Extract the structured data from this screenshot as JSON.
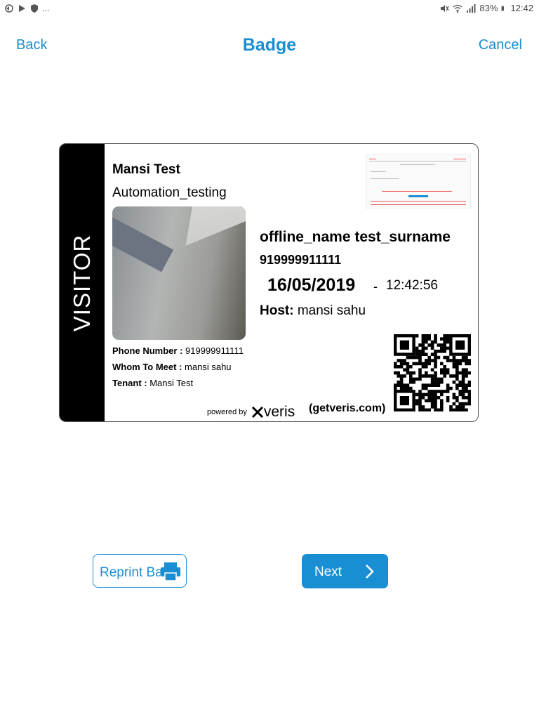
{
  "status_bar": {
    "left_more": "...",
    "battery": "83%",
    "time": "12:42"
  },
  "header": {
    "back_label": "Back",
    "title": "Badge",
    "cancel_label": "Cancel"
  },
  "badge": {
    "visitor_label": "VISITOR",
    "name": "Mansi Test",
    "company": "Automation_testing",
    "phone_label": "Phone Number :",
    "phone_value": "919999911111",
    "whom_label": "Whom To Meet :",
    "whom_value": "mansi sahu",
    "tenant_label": "Tenant :",
    "tenant_value": "Mansi Test",
    "visitor_fullname": "offline_name test_surname",
    "visitor_phone": "919999911111",
    "date": "16/05/2019",
    "separator": "-",
    "time": "12:42:56",
    "host_label": "Host:",
    "host_value": "mansi sahu",
    "powered_by": "powered by",
    "brand": "veris",
    "website": "(getveris.com)"
  },
  "actions": {
    "reprint_label": "Reprint Ba",
    "next_label": "Next"
  },
  "colors": {
    "accent": "#1a8ed3",
    "strip": "#000000"
  }
}
